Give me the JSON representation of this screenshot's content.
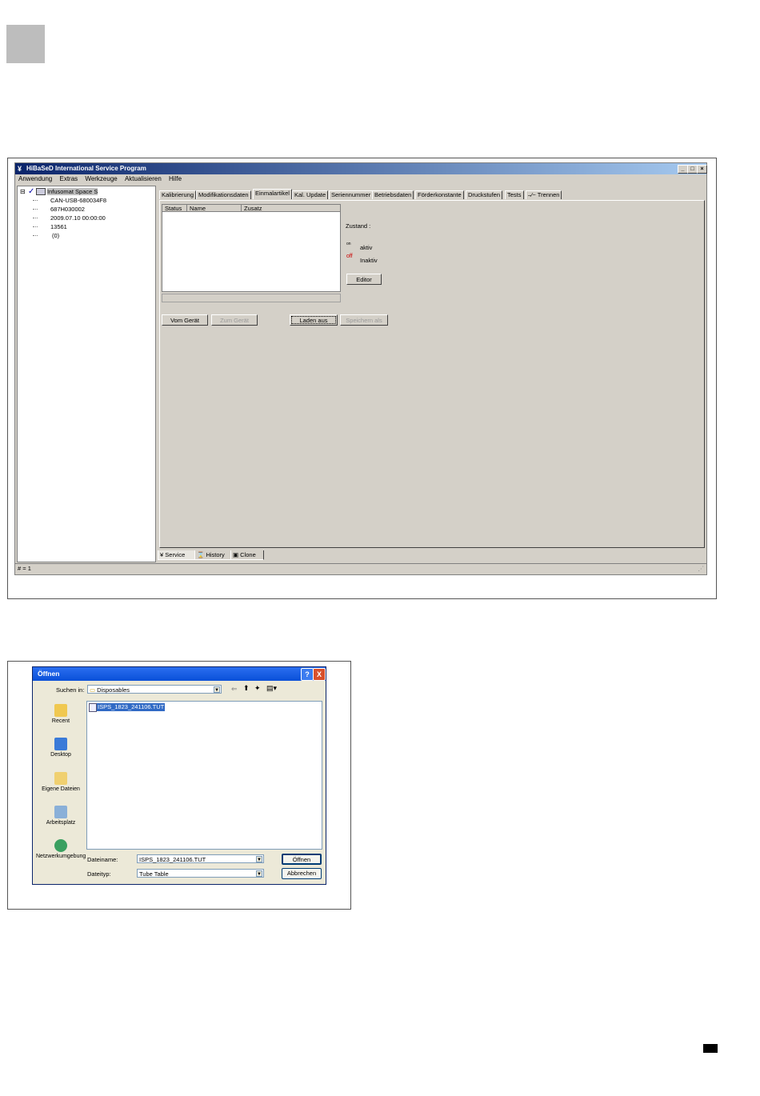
{
  "colors": {
    "titlebar": "#0a246a",
    "face": "#d4d0c8",
    "xp_title": "#0a50d8",
    "inaktiv": "#cc0000"
  },
  "main_window": {
    "title": "HiBaSeD  International  Service Program",
    "menu": [
      "Anwendung",
      "Extras",
      "Werkzeuge",
      "Aktualisieren",
      "Hilfe"
    ],
    "tree": {
      "root": "Infusomat Space S",
      "children": [
        "CAN-USB-680034F8",
        "687H030002",
        "2009.07.10 00:00:00",
        "13561",
        "(0)"
      ]
    },
    "tabs": [
      "Kalibrierung",
      "Modifikationsdaten",
      "Einmalartikel",
      "Kal. Update",
      "Seriennummer",
      "Betriebsdaten",
      "Förderkonstante",
      "Druckstufen",
      "Tests",
      "Trennen"
    ],
    "selected_tab": "Einmalartikel",
    "list_columns": [
      "Status",
      "Name",
      "Zusatz"
    ],
    "zustand_label": "Zustand :",
    "on_marker": "on",
    "aktiv_label": "aktiv",
    "off_marker": "off",
    "inaktiv_label": "Inaktiv",
    "editor_button": "Editor",
    "buttons": {
      "vom_geraet": "Vom Gerät",
      "zum_geraet": "Zum Gerät",
      "laden_aus": "Laden aus",
      "speichern_als": "Speichern als"
    },
    "bottom_tabs": [
      "Service",
      "History",
      "Clone"
    ],
    "status": "# = 1"
  },
  "open_dialog": {
    "title": "Öffnen",
    "look_in_label": "Suchen in:",
    "look_in_value": "Disposables",
    "places": [
      "Recent",
      "Desktop",
      "Eigene Dateien",
      "Arbeitsplatz",
      "Netzwerkumgebung"
    ],
    "files": [
      "ISPS_1823_241106.TUT"
    ],
    "filename_label": "Dateiname:",
    "filename_value": "ISPS_1823_241106.TUT",
    "filetype_label": "Dateityp:",
    "filetype_value": "Tube Table",
    "open_button": "Öffnen",
    "cancel_button": "Abbrechen",
    "help_button": "?",
    "close_button": "X"
  }
}
